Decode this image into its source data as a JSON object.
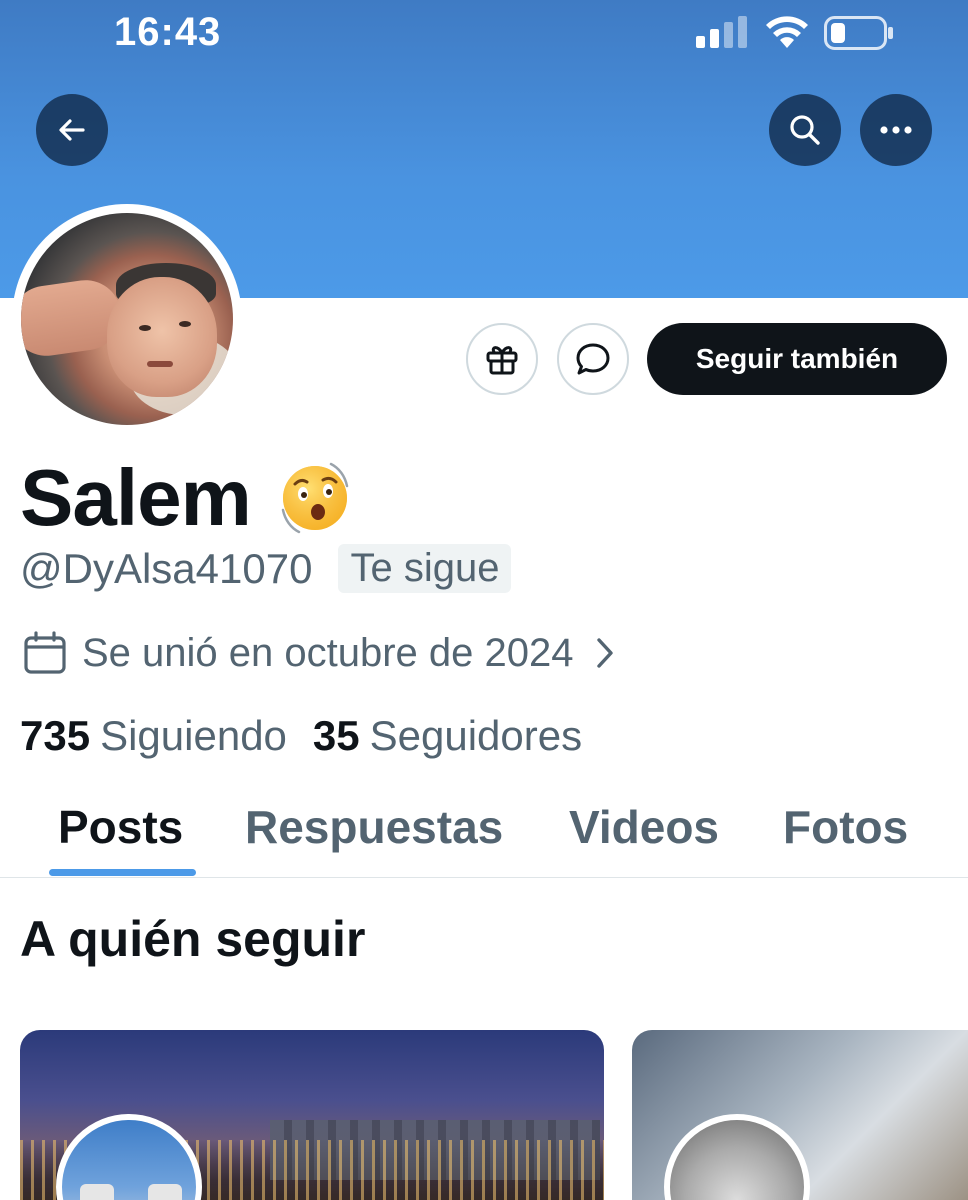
{
  "status_bar": {
    "time": "16:43"
  },
  "profile": {
    "display_name": "Salem",
    "handle": "@DyAlsa41070",
    "follows_you_badge": "Te sigue",
    "joined": "Se unió en octubre de 2024",
    "following_count": "735",
    "following_label": "Siguiendo",
    "followers_count": "35",
    "followers_label": "Seguidores"
  },
  "actions": {
    "follow_back_label": "Seguir también"
  },
  "tabs": [
    {
      "label": "Posts",
      "active": true
    },
    {
      "label": "Respuestas",
      "active": false
    },
    {
      "label": "Videos",
      "active": false
    },
    {
      "label": "Fotos",
      "active": false
    }
  ],
  "who_to_follow": {
    "title": "A quién seguir"
  },
  "icons": {
    "back": "arrow-left-icon",
    "search": "search-icon",
    "more": "more-horizontal-icon",
    "gift": "gift-icon",
    "message": "message-icon",
    "calendar": "calendar-icon",
    "chevron": "chevron-right-icon",
    "emoji": "astonished-face-emoji"
  },
  "colors": {
    "banner": "#4a93e0",
    "accent": "#4c9ae8",
    "primary_text": "#0f1419",
    "secondary_text": "#536471"
  }
}
